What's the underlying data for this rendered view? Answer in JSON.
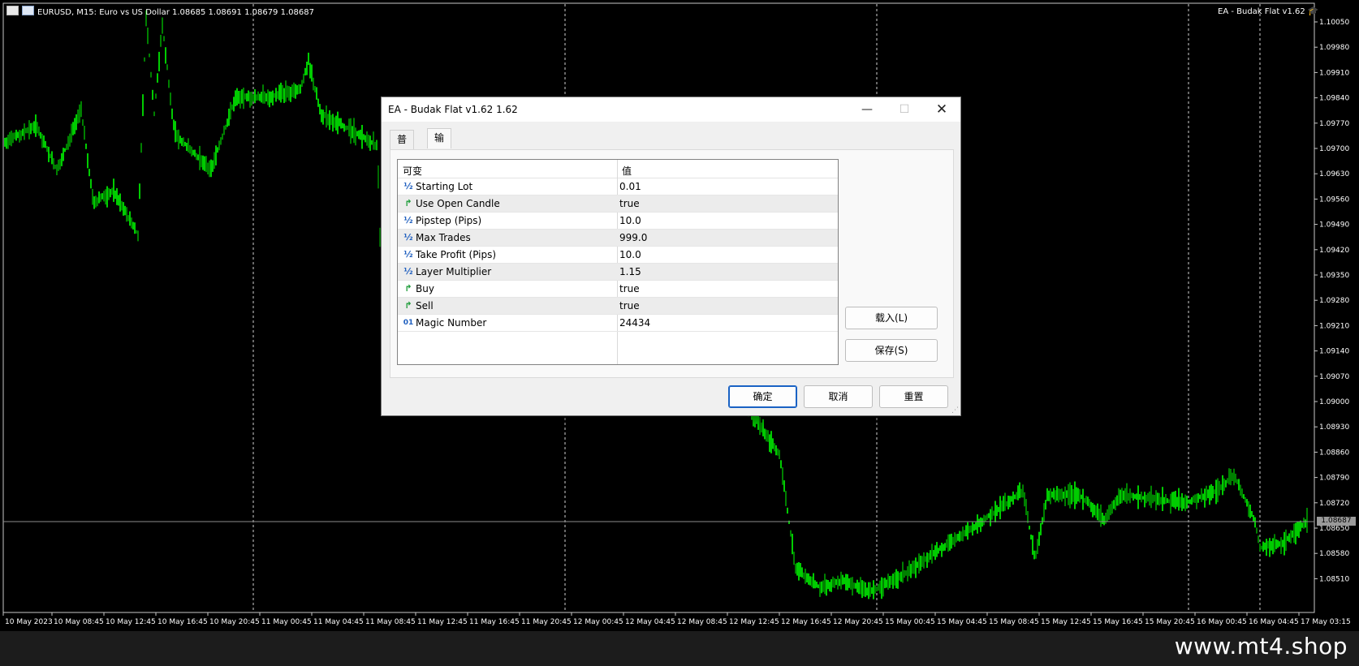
{
  "chart": {
    "symbol_header": "EURUSD, M15:  Euro vs US Dollar  1.08685 1.08691 1.08679 1.08687",
    "ea_label": "EA - Budak Flat v1.62",
    "current_price": "1.08687",
    "price_labels": [
      "1.10050",
      "1.09980",
      "1.09910",
      "1.09840",
      "1.09770",
      "1.09700",
      "1.09630",
      "1.09560",
      "1.09490",
      "1.09420",
      "1.09350",
      "1.09280",
      "1.09210",
      "1.09140",
      "1.09070",
      "1.09000",
      "1.08930",
      "1.08860",
      "1.08790",
      "1.08720",
      "1.08650",
      "1.08580",
      "1.08510"
    ],
    "time_labels": [
      "10 May 2023",
      "10 May 08:45",
      "10 May 12:45",
      "10 May 16:45",
      "10 May 20:45",
      "11 May 00:45",
      "11 May 04:45",
      "11 May 08:45",
      "11 May 12:45",
      "11 May 16:45",
      "11 May 20:45",
      "12 May 00:45",
      "12 May 04:45",
      "12 May 08:45",
      "12 May 12:45",
      "12 May 16:45",
      "12 May 20:45",
      "15 May 00:45",
      "15 May 04:45",
      "15 May 08:45",
      "15 May 12:45",
      "15 May 16:45",
      "15 May 20:45",
      "16 May 00:45",
      "16 May 04:45",
      "17 May 03:15"
    ],
    "colors": {
      "candle": "#00ff00",
      "grid": "#c8c8c8",
      "axis": "#ffffff"
    }
  },
  "dialog": {
    "title": "EA - Budak Flat v1.62 1.62",
    "tabs": [
      "普通",
      "输入"
    ],
    "active_tab": "输入",
    "columns": [
      "可变",
      "值"
    ],
    "params": [
      {
        "icon": "½",
        "type": "double",
        "name": "Starting Lot",
        "value": "0.01"
      },
      {
        "icon": "↱",
        "type": "bool",
        "name": "Use Open Candle",
        "value": "true"
      },
      {
        "icon": "½",
        "type": "double",
        "name": "Pipstep (Pips)",
        "value": "10.0"
      },
      {
        "icon": "½",
        "type": "double",
        "name": "Max Trades",
        "value": "999.0"
      },
      {
        "icon": "½",
        "type": "double",
        "name": "Take Profit (Pips)",
        "value": "10.0"
      },
      {
        "icon": "½",
        "type": "double",
        "name": "Layer Multiplier",
        "value": "1.15"
      },
      {
        "icon": "↱",
        "type": "bool",
        "name": "Buy",
        "value": "true"
      },
      {
        "icon": "↱",
        "type": "bool",
        "name": "Sell",
        "value": "true"
      },
      {
        "icon": "01",
        "type": "int",
        "name": "Magic Number",
        "value": "24434"
      }
    ],
    "load_label": "载入(L)",
    "save_label": "保存(S)",
    "ok_label": "确定",
    "cancel_label": "取消",
    "reset_label": "重置"
  },
  "watermark": "www.mt4.shop"
}
